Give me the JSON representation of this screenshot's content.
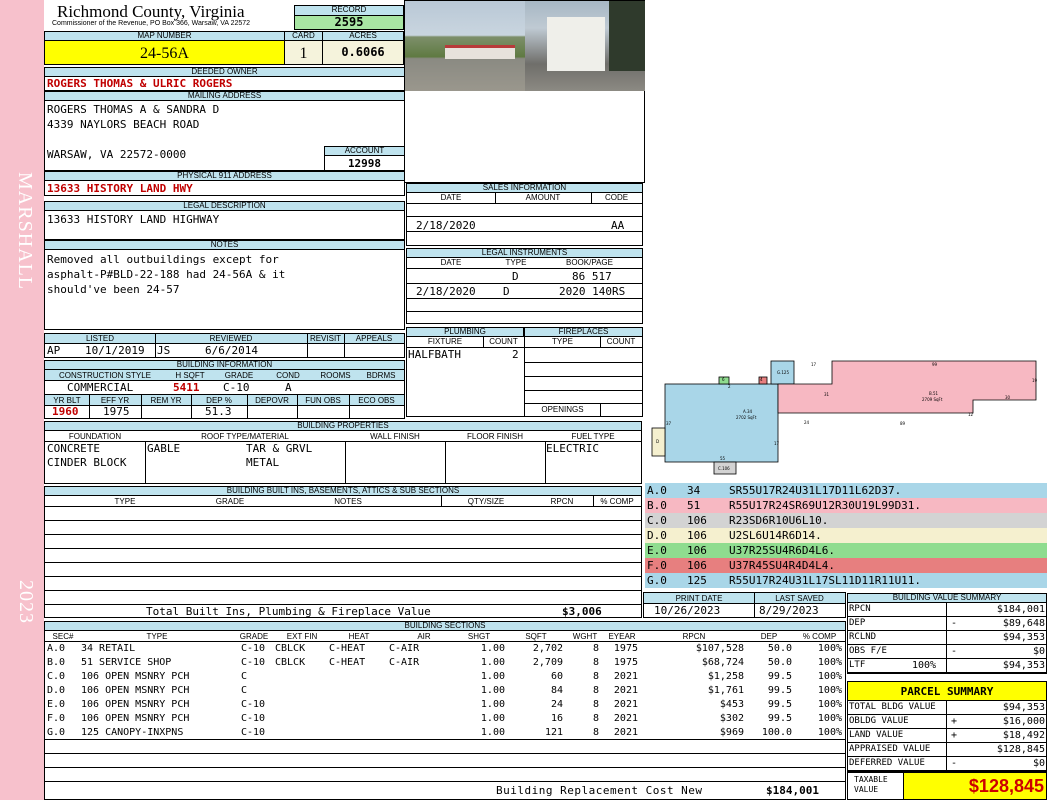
{
  "side": {
    "district": "MARSHALL",
    "year": "2023"
  },
  "header": {
    "county": "Richmond County, Virginia",
    "commissioner": "Commissioner of the Revenue, PO Box 366, Warsaw, VA 22572",
    "record_label": "RECORD",
    "record": "2595",
    "map_label": "MAP NUMBER",
    "map": "24-56A",
    "card_label": "CARD",
    "card": "1",
    "acres_label": "ACRES",
    "acres": "0.6066"
  },
  "owner": {
    "deeded_label": "DEEDED OWNER",
    "deeded": "ROGERS THOMAS & ULRIC ROGERS",
    "mailing_label": "MAILING ADDRESS",
    "mailing": [
      "ROGERS THOMAS A & SANDRA D",
      "4339 NAYLORS BEACH ROAD",
      "",
      "WARSAW, VA 22572-0000"
    ],
    "account_label": "ACCOUNT",
    "account": "12998",
    "physical_label": "PHYSICAL 911 ADDRESS",
    "physical": "13633 HISTORY LAND HWY",
    "legal_label": "LEGAL DESCRIPTION",
    "legal": "13633 HISTORY LAND HIGHWAY",
    "notes_label": "NOTES",
    "notes": [
      "Removed all outbuildings except for",
      "asphalt-P#BLD-22-188 had 24-56A & it",
      "should've been 24-57"
    ]
  },
  "sales": {
    "label": "SALES INFORMATION",
    "cols": [
      "DATE",
      "AMOUNT",
      "CODE"
    ],
    "rows": [
      {
        "date": "2/18/2020",
        "amount": "",
        "code": "AA"
      }
    ]
  },
  "legal_instruments": {
    "label": "LEGAL INSTRUMENTS",
    "cols": [
      "DATE",
      "TYPE",
      "BOOK/PAGE"
    ],
    "rows": [
      {
        "date": "",
        "type": "D",
        "book": "86 517"
      },
      {
        "date": "2/18/2020",
        "type": "D",
        "book": "2020 140RS"
      }
    ]
  },
  "plumbing": {
    "label": "PLUMBING",
    "cols": [
      "FIXTURE",
      "COUNT"
    ],
    "rows": [
      {
        "fixture": "HALFBATH",
        "count": "2"
      }
    ]
  },
  "fireplaces": {
    "label": "FIREPLACES",
    "cols": [
      "TYPE",
      "COUNT"
    ],
    "openings_label": "OPENINGS"
  },
  "listing": {
    "cols": [
      "LISTED",
      "REVIEWED",
      "REVISIT",
      "APPEALS"
    ],
    "listed_by": "AP",
    "listed": "10/1/2019",
    "reviewed_by": "JS",
    "reviewed": "6/6/2014"
  },
  "building_info": {
    "label": "BUILDING INFORMATION",
    "cols": [
      "CONSTRUCTION STYLE",
      "H SQFT",
      "GRADE",
      "COND",
      "ROOMS",
      "BDRMS"
    ],
    "style": "COMMERCIAL",
    "hsqft": "5411",
    "grade": "C-10",
    "cond": "A",
    "cols2": [
      "YR BLT",
      "EFF YR",
      "REM YR",
      "DEP %",
      "DEPOVR",
      "FUN OBS",
      "ECO OBS"
    ],
    "yr_blt": "1960",
    "eff_yr": "1975",
    "dep": "51.3"
  },
  "properties": {
    "label": "BUILDING PROPERTIES",
    "cols": [
      "FOUNDATION",
      "ROOF TYPE/MATERIAL",
      "WALL FINISH",
      "FLOOR FINISH",
      "FUEL TYPE"
    ],
    "foundation": [
      "CONCRETE",
      "CINDER BLOCK"
    ],
    "roof_type": "GABLE",
    "roof_material": [
      "TAR & GRVL",
      "METAL"
    ],
    "fuel": "ELECTRIC"
  },
  "builtins": {
    "label": "BUILDING BUILT INS, BASEMENTS, ATTICS & SUB SECTIONS",
    "cols": [
      "TYPE",
      "GRADE",
      "NOTES",
      "QTY/SIZE",
      "RPCN",
      "% COMP"
    ],
    "total_label": "Total Built Ins, Plumbing & Fireplace Value",
    "total": "$3,006"
  },
  "dates": {
    "print_label": "PRINT DATE",
    "print": "10/26/2023",
    "saved_label": "LAST SAVED",
    "saved": "8/29/2023"
  },
  "sketch_legend": [
    {
      "id": "A.0",
      "code": "34",
      "vec": "SR55U17R24U31L17D11L62D37.",
      "color": "#a9d6e8"
    },
    {
      "id": "B.0",
      "code": "51",
      "vec": "R55U17R24SR69U12R30U19L99D31.",
      "color": "#f7b8c2"
    },
    {
      "id": "C.0",
      "code": "106",
      "vec": "R23SD6R10U6L10.",
      "color": "#d3d3d3"
    },
    {
      "id": "D.0",
      "code": "106",
      "vec": "U2SL6U14R6D14.",
      "color": "#f5f0cf"
    },
    {
      "id": "E.0",
      "code": "106",
      "vec": "U37R25SU4R6D4L6.",
      "color": "#8fdc8f"
    },
    {
      "id": "F.0",
      "code": "106",
      "vec": "U37R45SU4R4D4L4.",
      "color": "#e77f7f"
    },
    {
      "id": "G.0",
      "code": "125",
      "vec": "R55U17R24U31L17SL11D11R11U11.",
      "color": "#a9d6e8"
    }
  ],
  "sketch": {
    "a_label": "A.34",
    "a_area": "2702 SqFt",
    "b_label": "B.51",
    "b_area": "2709 SqFt",
    "g_label": "G.125",
    "c_label": "C.106",
    "d_label": "D",
    "dims": [
      "17",
      "55",
      "31",
      "24",
      "17",
      "99",
      "19",
      "30",
      "12",
      "89",
      "37",
      "6",
      "2",
      "4",
      "11",
      "11"
    ]
  },
  "sections": {
    "label": "BUILDING SECTIONS",
    "cols": [
      "SEC#",
      "TYPE",
      "GRADE",
      "EXT FIN",
      "HEAT",
      "AIR",
      "SHGT",
      "SQFT",
      "WGHT",
      "EYEAR",
      "RPCN",
      "DEP",
      "% COMP"
    ],
    "rows": [
      {
        "sec": "A.0",
        "type": "34 RETAIL",
        "grade": "C-10",
        "ext": "CBLCK",
        "heat": "C-HEAT",
        "air": "C-AIR",
        "shgt": "1.00",
        "sqft": "2,702",
        "wght": "8",
        "eyear": "1975",
        "rpcn": "$107,528",
        "dep": "50.0",
        "comp": "100%"
      },
      {
        "sec": "B.0",
        "type": "51 SERVICE SHOP",
        "grade": "C-10",
        "ext": "CBLCK",
        "heat": "C-HEAT",
        "air": "C-AIR",
        "shgt": "1.00",
        "sqft": "2,709",
        "wght": "8",
        "eyear": "1975",
        "rpcn": "$68,724",
        "dep": "50.0",
        "comp": "100%"
      },
      {
        "sec": "C.0",
        "type": "106 OPEN MSNRY PCH",
        "grade": "C",
        "ext": "",
        "heat": "",
        "air": "",
        "shgt": "1.00",
        "sqft": "60",
        "wght": "8",
        "eyear": "2021",
        "rpcn": "$1,258",
        "dep": "99.5",
        "comp": "100%"
      },
      {
        "sec": "D.0",
        "type": "106 OPEN MSNRY PCH",
        "grade": "C",
        "ext": "",
        "heat": "",
        "air": "",
        "shgt": "1.00",
        "sqft": "84",
        "wght": "8",
        "eyear": "2021",
        "rpcn": "$1,761",
        "dep": "99.5",
        "comp": "100%"
      },
      {
        "sec": "E.0",
        "type": "106 OPEN MSNRY PCH",
        "grade": "C-10",
        "ext": "",
        "heat": "",
        "air": "",
        "shgt": "1.00",
        "sqft": "24",
        "wght": "8",
        "eyear": "2021",
        "rpcn": "$453",
        "dep": "99.5",
        "comp": "100%"
      },
      {
        "sec": "F.0",
        "type": "106 OPEN MSNRY PCH",
        "grade": "C-10",
        "ext": "",
        "heat": "",
        "air": "",
        "shgt": "1.00",
        "sqft": "16",
        "wght": "8",
        "eyear": "2021",
        "rpcn": "$302",
        "dep": "99.5",
        "comp": "100%"
      },
      {
        "sec": "G.0",
        "type": "125 CANOPY-INXPNS",
        "grade": "C-10",
        "ext": "",
        "heat": "",
        "air": "",
        "shgt": "1.00",
        "sqft": "121",
        "wght": "8",
        "eyear": "2021",
        "rpcn": "$969",
        "dep": "100.0",
        "comp": "100%"
      }
    ],
    "total_label": "Building Replacement Cost New",
    "total": "$184,001"
  },
  "value_summary": {
    "label": "BUILDING VALUE SUMMARY",
    "rows": [
      {
        "k": "RPCN",
        "op": "",
        "v": "$184,001"
      },
      {
        "k": "DEP",
        "op": "-",
        "v": "$89,648"
      },
      {
        "k": "RCLND",
        "op": "",
        "v": "$94,353"
      },
      {
        "k": "OBS F/E",
        "op": "-",
        "v": "$0"
      },
      {
        "k": "LTF",
        "op": "100%",
        "v": "$94,353"
      }
    ]
  },
  "parcel": {
    "label": "PARCEL SUMMARY",
    "rows": [
      {
        "k": "TOTAL BLDG VALUE",
        "op": "",
        "v": "$94,353"
      },
      {
        "k": "OBLDG VALUE",
        "op": "+",
        "v": "$16,000"
      },
      {
        "k": "LAND VALUE",
        "op": "+",
        "v": "$18,492"
      },
      {
        "k": "APPRAISED VALUE",
        "op": "",
        "v": "$128,845"
      },
      {
        "k": "DEFERRED VALUE",
        "op": "-",
        "v": "$0"
      }
    ],
    "taxable_label": "TAXABLE VALUE",
    "taxable": "$128,845"
  }
}
